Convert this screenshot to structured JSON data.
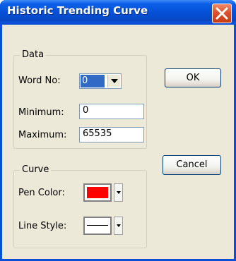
{
  "window": {
    "title": "Historic Trending Curve",
    "close_icon": "close-icon",
    "colors": {
      "titlebar": "#0550d8",
      "close": "#e0502a",
      "face": "#ece9d8"
    }
  },
  "data_group": {
    "label": "Data",
    "word_no_label": "Word No:",
    "word_no_value": "0",
    "minimum_label": "Minimum:",
    "minimum_value": "0",
    "maximum_label": "Maximum:",
    "maximum_value": "65535"
  },
  "curve_group": {
    "label": "Curve",
    "pen_color_label": "Pen Color:",
    "pen_color": "#ff0000",
    "line_style_label": "Line Style:",
    "line_style_icon": "solid-line-icon"
  },
  "buttons": {
    "ok": "OK",
    "cancel": "Cancel"
  }
}
